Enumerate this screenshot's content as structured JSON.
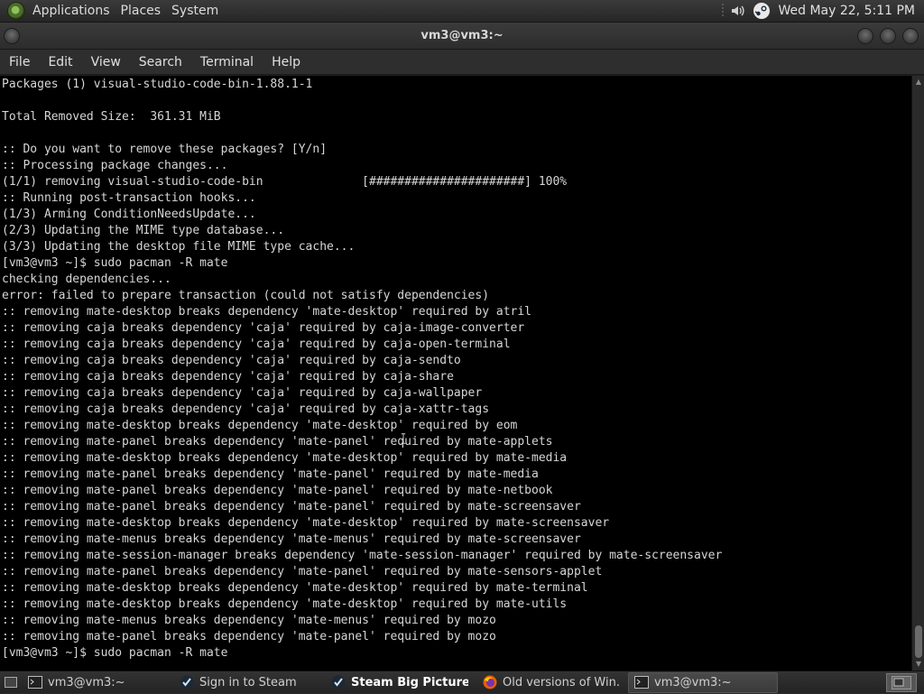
{
  "top_panel": {
    "menus": [
      "Applications",
      "Places",
      "System"
    ],
    "clock": "Wed May 22,  5:11 PM"
  },
  "window": {
    "title": "vm3@vm3:~",
    "menubar": [
      "File",
      "Edit",
      "View",
      "Search",
      "Terminal",
      "Help"
    ]
  },
  "terminal": {
    "lines": [
      "Packages (1) visual-studio-code-bin-1.88.1-1",
      "",
      "Total Removed Size:  361.31 MiB",
      "",
      ":: Do you want to remove these packages? [Y/n]",
      ":: Processing package changes...",
      "(1/1) removing visual-studio-code-bin              [######################] 100%",
      ":: Running post-transaction hooks...",
      "(1/3) Arming ConditionNeedsUpdate...",
      "(2/3) Updating the MIME type database...",
      "(3/3) Updating the desktop file MIME type cache...",
      "[vm3@vm3 ~]$ sudo pacman -R mate",
      "checking dependencies...",
      "error: failed to prepare transaction (could not satisfy dependencies)",
      ":: removing mate-desktop breaks dependency 'mate-desktop' required by atril",
      ":: removing caja breaks dependency 'caja' required by caja-image-converter",
      ":: removing caja breaks dependency 'caja' required by caja-open-terminal",
      ":: removing caja breaks dependency 'caja' required by caja-sendto",
      ":: removing caja breaks dependency 'caja' required by caja-share",
      ":: removing caja breaks dependency 'caja' required by caja-wallpaper",
      ":: removing caja breaks dependency 'caja' required by caja-xattr-tags",
      ":: removing mate-desktop breaks dependency 'mate-desktop' required by eom",
      ":: removing mate-panel breaks dependency 'mate-panel' required by mate-applets",
      ":: removing mate-desktop breaks dependency 'mate-desktop' required by mate-media",
      ":: removing mate-panel breaks dependency 'mate-panel' required by mate-media",
      ":: removing mate-panel breaks dependency 'mate-panel' required by mate-netbook",
      ":: removing mate-panel breaks dependency 'mate-panel' required by mate-screensaver",
      ":: removing mate-desktop breaks dependency 'mate-desktop' required by mate-screensaver",
      ":: removing mate-menus breaks dependency 'mate-menus' required by mate-screensaver",
      ":: removing mate-session-manager breaks dependency 'mate-session-manager' required by mate-screensaver",
      ":: removing mate-panel breaks dependency 'mate-panel' required by mate-sensors-applet",
      ":: removing mate-desktop breaks dependency 'mate-desktop' required by mate-terminal",
      ":: removing mate-desktop breaks dependency 'mate-desktop' required by mate-utils",
      ":: removing mate-menus breaks dependency 'mate-menus' required by mozo",
      ":: removing mate-panel breaks dependency 'mate-panel' required by mozo",
      "[vm3@vm3 ~]$ sudo pacman -R mate"
    ]
  },
  "taskbar": {
    "tasks": [
      {
        "label": "vm3@vm3:~",
        "icon": "terminal-icon"
      },
      {
        "label": "Sign in to Steam",
        "icon": "steam-icon"
      },
      {
        "label": "Steam Big Picture ...",
        "icon": "steam-icon"
      },
      {
        "label": "Old versions of Win...",
        "icon": "firefox-icon"
      },
      {
        "label": "vm3@vm3:~",
        "icon": "terminal-icon"
      }
    ]
  }
}
